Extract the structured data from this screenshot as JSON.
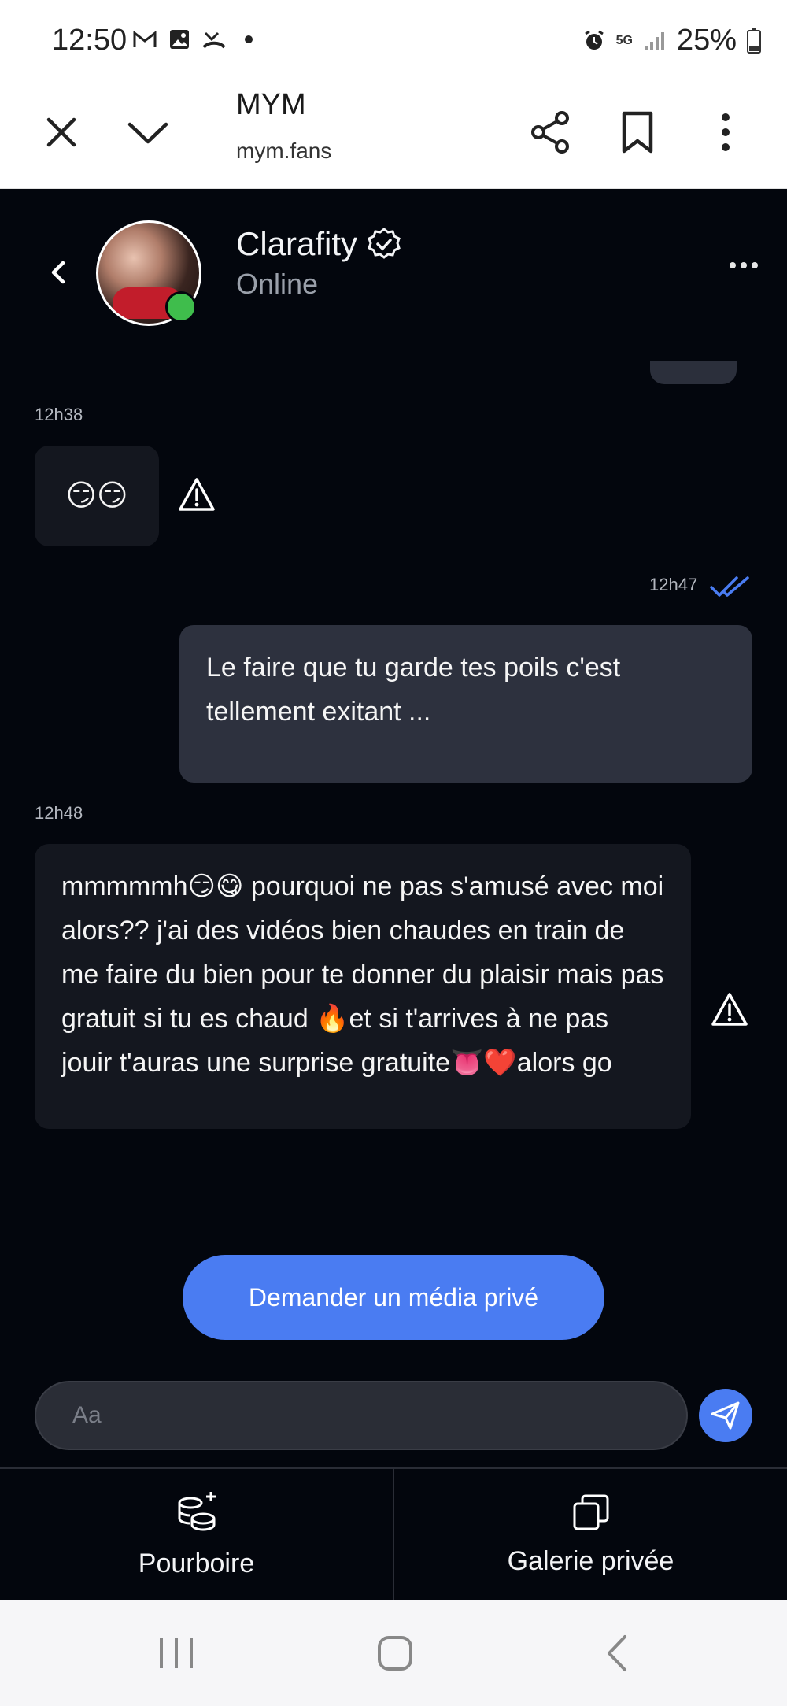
{
  "status_bar": {
    "time": "12:50",
    "network": "5G",
    "battery": "25%",
    "left_icons": [
      "gmail-icon",
      "gallery-icon",
      "missed-call-icon",
      "dot-icon"
    ],
    "right_icons": [
      "alarm-icon",
      "signal-icon",
      "battery-icon"
    ]
  },
  "browser": {
    "title": "MYM",
    "url": "mym.fans"
  },
  "chat_header": {
    "name": "Clarafity",
    "status": "Online"
  },
  "messages": [
    {
      "time": "12h38",
      "direction": "in",
      "text": "😏😏"
    },
    {
      "time": "12h47",
      "direction": "out",
      "text": "Le faire que tu garde tes poils c'est tellement exitant ..."
    },
    {
      "time": "12h48",
      "direction": "in",
      "text": "mmmmmh😏😋 pourquoi ne pas s'amusé avec moi alors?? j'ai des vidéos bien chaudes en train de me faire du bien pour te donner du plaisir mais pas gratuit si tu es chaud 🔥et si t'arrives à ne pas jouir t'auras une surprise gratuite👅❤️alors go"
    }
  ],
  "cta": {
    "label": "Demander un média privé"
  },
  "composer": {
    "placeholder": "Aa"
  },
  "tabs": [
    {
      "label": "Pourboire",
      "icon": "coins-plus-icon"
    },
    {
      "label": "Galerie privée",
      "icon": "gallery-copy-icon"
    }
  ],
  "colors": {
    "chat_bg": "#03060d",
    "accent": "#4a7cf2",
    "incoming_bubble": "#14171f",
    "outgoing_bubble": "#2d313e",
    "online": "#3fbd4c"
  }
}
